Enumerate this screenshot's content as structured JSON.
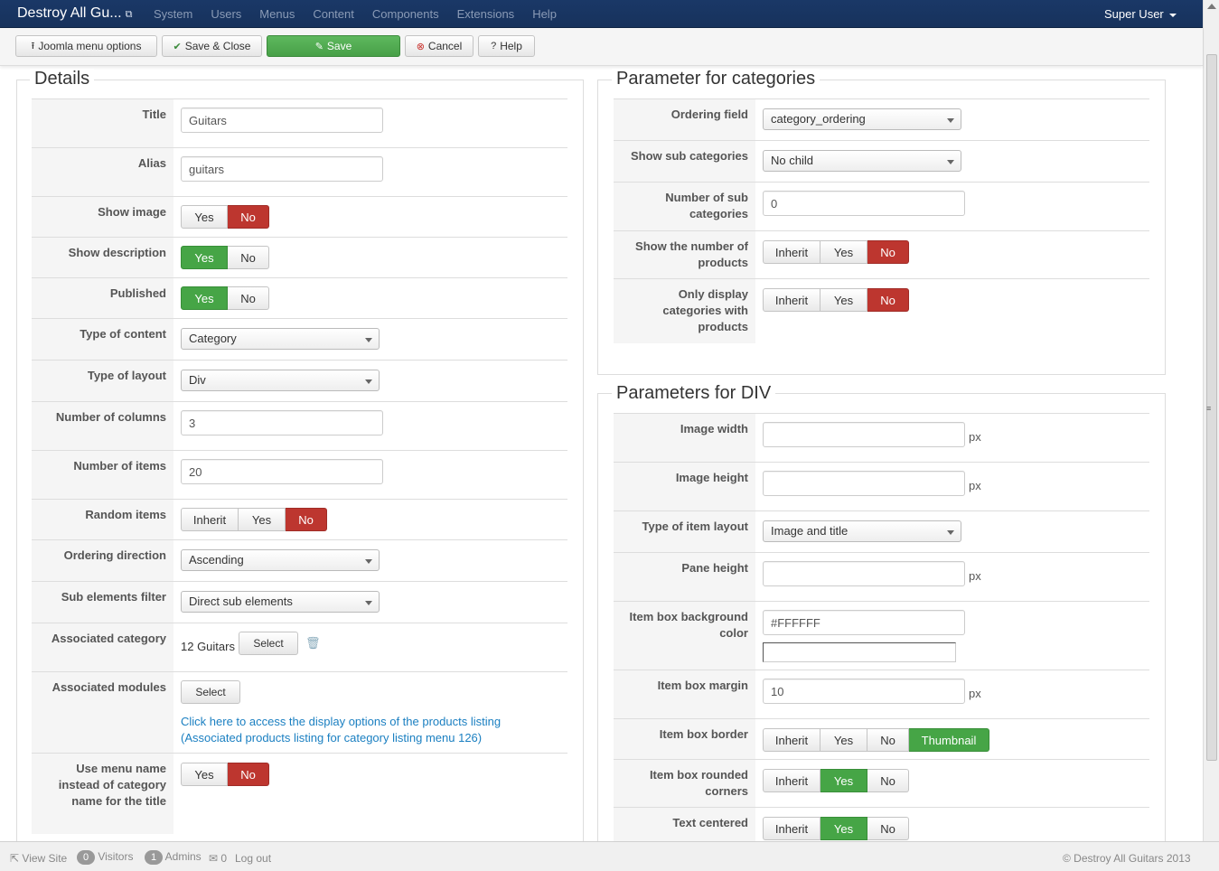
{
  "navbar": {
    "brand": "Destroy All Gu...",
    "menu": [
      "System",
      "Users",
      "Menus",
      "Content",
      "Components",
      "Extensions",
      "Help"
    ],
    "user": "Super User"
  },
  "toolbar": {
    "joomla_menu_options": "Joomla menu options",
    "save_close": "Save & Close",
    "save": "Save",
    "cancel": "Cancel",
    "help": "Help"
  },
  "details": {
    "legend": "Details",
    "title_label": "Title",
    "title_value": "Guitars",
    "alias_label": "Alias",
    "alias_value": "guitars",
    "show_image_label": "Show image",
    "show_description_label": "Show description",
    "published_label": "Published",
    "type_content_label": "Type of content",
    "type_content_value": "Category",
    "type_layout_label": "Type of layout",
    "type_layout_value": "Div",
    "num_columns_label": "Number of columns",
    "num_columns_value": "3",
    "num_items_label": "Number of items",
    "num_items_value": "20",
    "random_items_label": "Random items",
    "ordering_direction_label": "Ordering direction",
    "ordering_direction_value": "Ascending",
    "sub_elements_label": "Sub elements filter",
    "sub_elements_value": "Direct sub elements",
    "assoc_category_label": "Associated category",
    "assoc_category_value": "12 Guitars",
    "assoc_modules_label": "Associated modules",
    "link_line1": "Click here to access the display options of the products listing",
    "link_line2": "(Associated products listing for category listing menu 126)",
    "use_menu_name_label": "Use menu name instead of category name for the title"
  },
  "common": {
    "yes": "Yes",
    "no": "No",
    "inherit": "Inherit",
    "select": "Select",
    "px": "px",
    "thumbnail": "Thumbnail"
  },
  "categories": {
    "legend": "Parameter for categories",
    "ordering_field_label": "Ordering field",
    "ordering_field_value": "category_ordering",
    "show_sub_label": "Show sub categories",
    "show_sub_value": "No child",
    "num_sub_label": "Number of sub categories",
    "num_sub_value": "0",
    "show_number_label": "Show the number of products",
    "only_display_label": "Only display categories with products"
  },
  "div": {
    "legend": "Parameters for DIV",
    "image_width_label": "Image width",
    "image_width_value": "",
    "image_height_label": "Image height",
    "image_height_value": "",
    "item_layout_label": "Type of item layout",
    "item_layout_value": "Image and title",
    "pane_height_label": "Pane height",
    "pane_height_value": "",
    "bg_color_label": "Item box background color",
    "bg_color_value": "#FFFFFF",
    "margin_label": "Item box margin",
    "margin_value": "10",
    "border_label": "Item box border",
    "rounded_label": "Item box rounded corners",
    "text_centered_label": "Text centered"
  },
  "footer": {
    "view_site": "View Site",
    "visitors_count": "0",
    "visitors": "Visitors",
    "admins_count": "1",
    "admins": "Admins",
    "messages_count": "0",
    "logout": "Log out",
    "copyright": "© Destroy All Guitars 2013"
  },
  "colors": {
    "navbar": "#17325c",
    "green": "#46a546",
    "red": "#bd362f",
    "link": "#1a7fc1"
  }
}
